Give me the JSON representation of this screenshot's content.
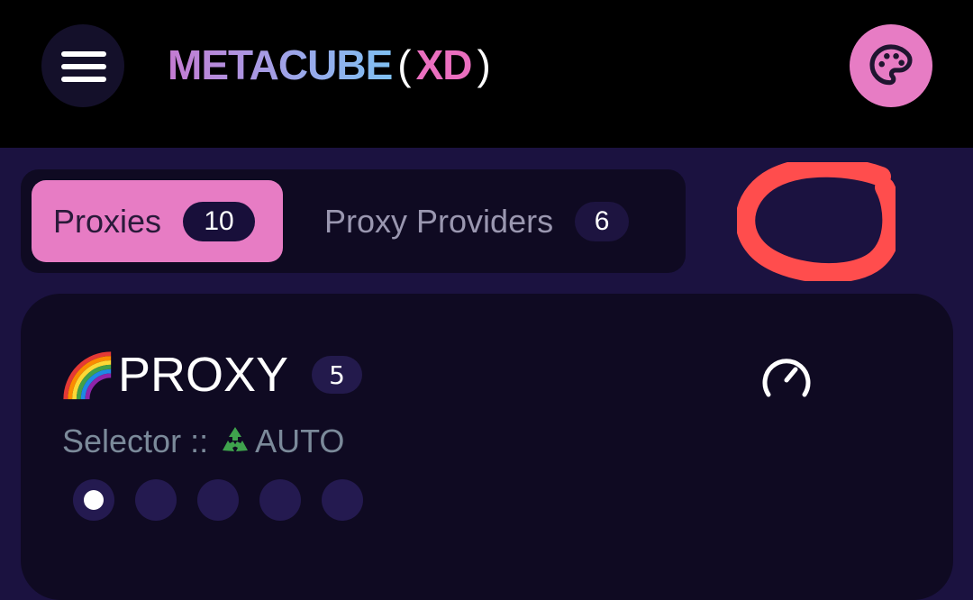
{
  "header": {
    "logo_main": "METACUBE",
    "logo_open": "(",
    "logo_xd": "XD",
    "logo_close": ")",
    "menu_icon": "hamburger-menu-icon",
    "theme_icon": "palette-icon"
  },
  "tabs": [
    {
      "label": "Proxies",
      "count": "10",
      "active": true
    },
    {
      "label": "Proxy Providers",
      "count": "6",
      "active": false
    }
  ],
  "group": {
    "emoji_icon": "rainbow-icon",
    "name": "PROXY",
    "count": "5",
    "type": "Selector ::",
    "selected_icon": "recycle-icon",
    "selected": "AUTO",
    "test_icon": "speedometer-icon",
    "proxy_dots": 5,
    "active_dot": 0
  },
  "colors": {
    "accent": "#e77cc4",
    "background": "#1b1240",
    "card": "#0f0a22",
    "topbar": "#000000",
    "annotation": "#ff4d4d"
  }
}
